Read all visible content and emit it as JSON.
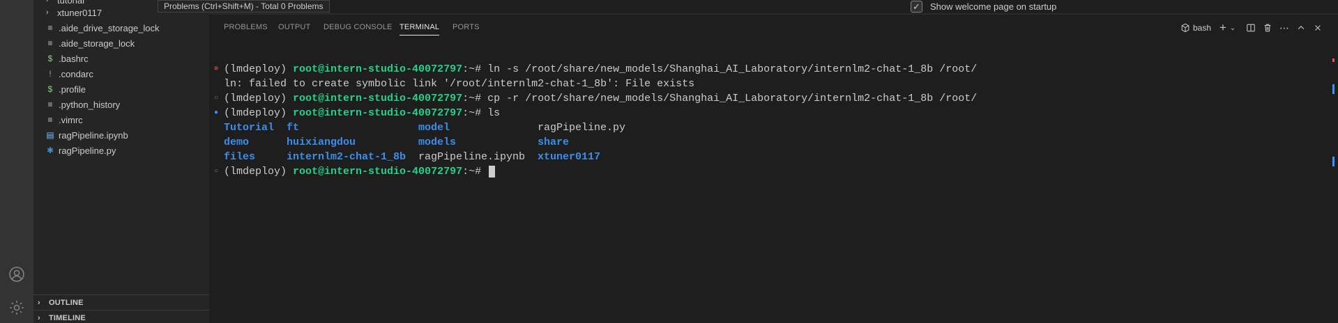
{
  "explorer": {
    "items": [
      {
        "type": "folder",
        "label": "tutorial"
      },
      {
        "type": "folder",
        "label": "xtuner0117"
      },
      {
        "type": "file",
        "label": ".aide_drive_storage_lock",
        "icon": "lines-file-icon",
        "glyph": "≡",
        "color": "#c5c5c5"
      },
      {
        "type": "file",
        "label": ".aide_storage_lock",
        "icon": "lines-file-icon",
        "glyph": "≡",
        "color": "#c5c5c5"
      },
      {
        "type": "file",
        "label": ".bashrc",
        "icon": "dollar-file-icon",
        "glyph": "$",
        "color": "#89d185"
      },
      {
        "type": "file",
        "label": ".condarc",
        "icon": "exclamation-file-icon",
        "glyph": "!",
        "color": "#c586c0"
      },
      {
        "type": "file",
        "label": ".profile",
        "icon": "dollar-file-icon",
        "glyph": "$",
        "color": "#89d185"
      },
      {
        "type": "file",
        "label": ".python_history",
        "icon": "lines-file-icon",
        "glyph": "≡",
        "color": "#c5c5c5"
      },
      {
        "type": "file",
        "label": ".vimrc",
        "icon": "lines-file-icon",
        "glyph": "≡",
        "color": "#c5c5c5"
      },
      {
        "type": "file",
        "label": "ragPipeline.ipynb",
        "icon": "notebook-file-icon",
        "glyph": "▤",
        "color": "#75beff"
      },
      {
        "type": "file",
        "label": "ragPipeline.py",
        "icon": "python-file-icon",
        "glyph": "✱",
        "color": "#4b8bbe"
      }
    ],
    "sections": {
      "outline": "OUTLINE",
      "timeline": "TIMELINE"
    }
  },
  "tooltip": "Problems (Ctrl+Shift+M) - Total 0 Problems",
  "welcome": {
    "checkbox_label": "Show welcome page on startup",
    "checked": true
  },
  "panel": {
    "tabs": [
      "PROBLEMS",
      "OUTPUT",
      "DEBUG CONSOLE",
      "TERMINAL",
      "PORTS"
    ],
    "active_tab": "TERMINAL",
    "terminal_name": "bash"
  },
  "terminal": {
    "env": "(lmdeploy)",
    "user_host": "root@intern-studio-40072797",
    "path_sep": ":~# ",
    "commands": [
      {
        "status": "error",
        "cmd": "ln -s /root/share/new_models/Shanghai_AI_Laboratory/internlm2-chat-1_8b /root/"
      },
      {
        "status": "success",
        "cmd": "cp -r /root/share/new_models/Shanghai_AI_Laboratory/internlm2-chat-1_8b /root/"
      },
      {
        "status": "running",
        "cmd": "ls"
      }
    ],
    "error_output": "ln: failed to create symbolic link '/root/internlm2-chat-1_8b': File exists",
    "ls_output": [
      [
        {
          "name": "Tutorial",
          "dir": true
        },
        {
          "name": "ft",
          "dir": true
        },
        {
          "name": "model",
          "dir": true
        },
        {
          "name": "ragPipeline.py",
          "dir": false
        }
      ],
      [
        {
          "name": "demo",
          "dir": true
        },
        {
          "name": "huixiangdou",
          "dir": true
        },
        {
          "name": "models",
          "dir": true
        },
        {
          "name": "share",
          "dir": true
        }
      ],
      [
        {
          "name": "files",
          "dir": true
        },
        {
          "name": "internlm2-chat-1_8b",
          "dir": true
        },
        {
          "name": "ragPipeline.ipynb",
          "dir": false
        },
        {
          "name": "xtuner0117",
          "dir": true
        }
      ]
    ]
  }
}
